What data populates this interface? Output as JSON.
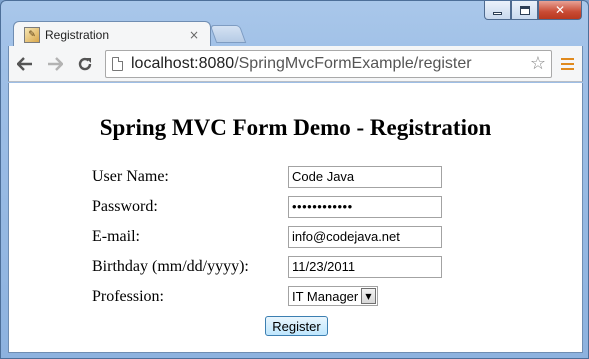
{
  "browser": {
    "tab_title": "Registration",
    "tab_close": "×",
    "url_host": "localhost:8080",
    "url_path": "/SpringMvcFormExample/register",
    "back_icon": "arrow-left-icon",
    "forward_icon": "arrow-right-icon",
    "reload_icon": "reload-icon",
    "bookmark_icon": "star-icon",
    "menu_icon": "hamburger-menu-icon",
    "menu_color": "#e08a1e"
  },
  "window_controls": {
    "minimize": "minimize-icon",
    "maximize": "maximize-icon",
    "close_glyph": "✕"
  },
  "page": {
    "heading": "Spring MVC Form Demo - Registration",
    "fields": {
      "username": {
        "label": "User Name:",
        "value": "Code Java"
      },
      "password": {
        "label": "Password:",
        "value": "••••••••••••"
      },
      "email": {
        "label": "E-mail:",
        "value": "info@codejava.net"
      },
      "birthday": {
        "label": "Birthday (mm/dd/yyyy):",
        "value": "11/23/2011"
      },
      "profession": {
        "label": "Profession:",
        "value": "IT Manager"
      }
    },
    "submit_label": "Register"
  }
}
